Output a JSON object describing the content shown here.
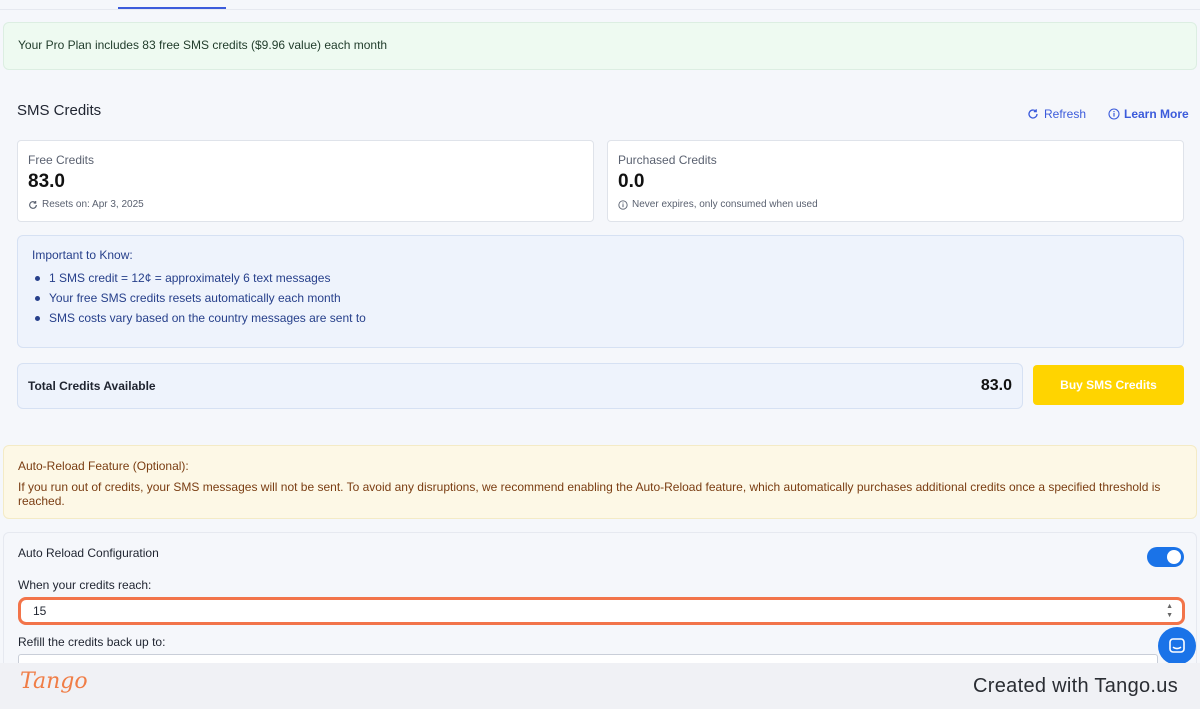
{
  "plan_banner": {
    "text": "Your Pro Plan includes 83 free SMS credits ($9.96 value) each month"
  },
  "sms_credits": {
    "title": "SMS Credits",
    "refresh_label": "Refresh",
    "learn_more_label": "Learn More",
    "free": {
      "label": "Free Credits",
      "value": "83.0",
      "note": "Resets on: Apr 3, 2025"
    },
    "purchased": {
      "label": "Purchased Credits",
      "value": "0.0",
      "note": "Never expires, only consumed when used"
    },
    "important": {
      "title": "Important to Know:",
      "items": [
        "1 SMS credit = 12¢ = approximately 6 text messages",
        "Your free SMS credits resets automatically each month",
        "SMS costs vary based on the country messages are sent to"
      ]
    },
    "total": {
      "label": "Total Credits Available",
      "value": "83.0"
    },
    "buy_label": "Buy SMS Credits"
  },
  "auto_reload_notice": {
    "title": "Auto-Reload Feature (Optional):",
    "text": "If you run out of credits, your SMS messages will not be sent. To avoid any disruptions, we recommend enabling the Auto-Reload feature, which automatically purchases additional credits once a specified threshold is reached."
  },
  "auto_reload_config": {
    "title": "Auto Reload Configuration",
    "enabled": true,
    "threshold_label": "When your credits reach:",
    "threshold_value": "15",
    "refill_label": "Refill the credits back up to:"
  },
  "footer": {
    "logo": "Tango",
    "created_with": "Created with Tango.us"
  },
  "colors": {
    "accent": "#3b5bdb",
    "buy_button": "#ffd400",
    "toggle_on": "#1a73e8",
    "highlight": "#f2744a",
    "tango_orange": "#f07d46"
  }
}
